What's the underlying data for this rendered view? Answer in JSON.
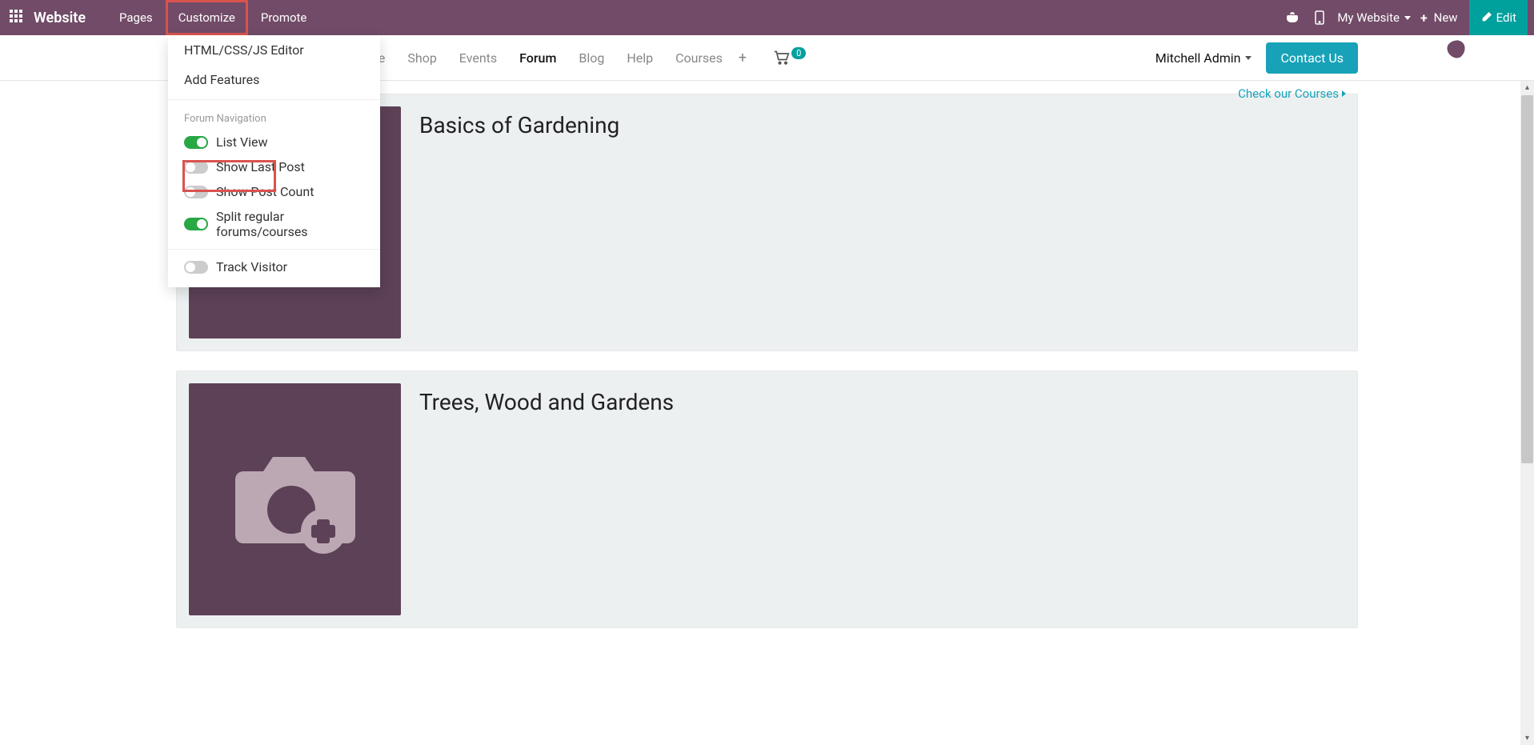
{
  "topbar": {
    "brand": "Website",
    "nav": {
      "pages": "Pages",
      "customize": "Customize",
      "promote": "Promote"
    },
    "my_website": "My Website",
    "new": "New",
    "edit": "Edit"
  },
  "siteheader": {
    "nav": {
      "home_frag": "ie",
      "shop": "Shop",
      "events": "Events",
      "forum": "Forum",
      "blog": "Blog",
      "help": "Help",
      "courses": "Courses"
    },
    "cart_count": "0",
    "user": "Mitchell Admin",
    "contact": "Contact Us"
  },
  "courses_link": "Check our Courses",
  "dropdown": {
    "html_editor": "HTML/CSS/JS Editor",
    "add_features": "Add Features",
    "section": "Forum Navigation",
    "list_view": "List View",
    "show_last_post": "Show Last Post",
    "show_post_count": "Show Post Count",
    "split": "Split regular forums/courses",
    "track": "Track Visitor"
  },
  "forums": [
    {
      "title": "Basics of Gardening"
    },
    {
      "title": "Trees, Wood and Gardens"
    }
  ]
}
